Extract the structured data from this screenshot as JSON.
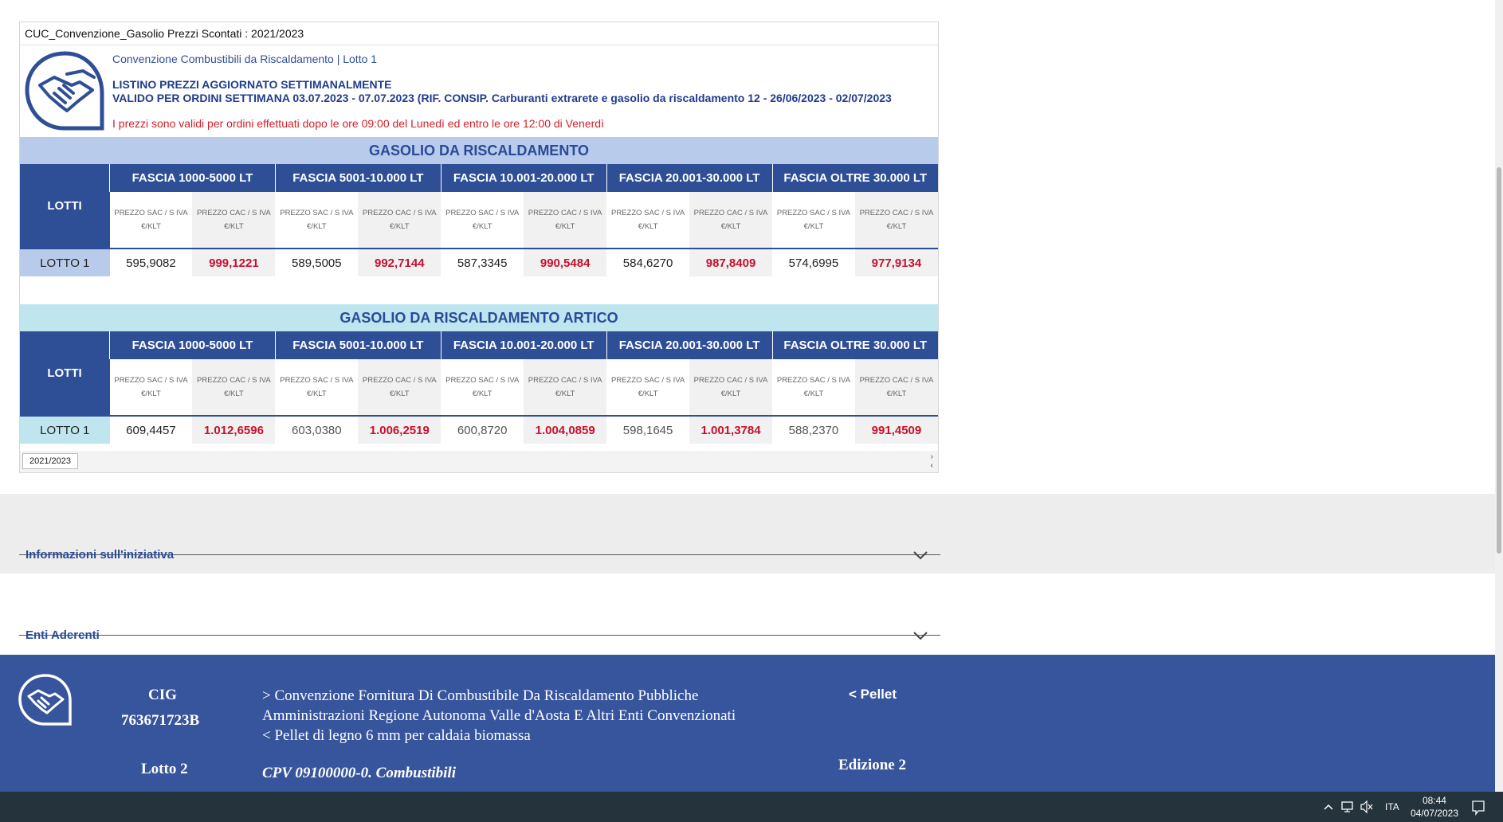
{
  "report": {
    "title": "CUC_Convenzione_Gasolio Prezzi Scontati : 2021/2023",
    "subtitle": "Convenzione Combustibili da Riscaldamento | Lotto 1",
    "headline_1": "LISTINO PREZZI AGGIORNATO SETTIMANALMENTE",
    "headline_2": "VALIDO PER ORDINI SETTIMANA 03.07.2023 - 07.07.2023 (RIF. CONSIP. Carburanti extrarete e gasolio da riscaldamento 12 - 26/06/2023 - 02/07/2023",
    "notice": "I prezzi sono validi per ordini effettuati dopo le ore 09:00 del Lunedì ed entro le ore 12:00 di Venerdì",
    "tab_label": "2021/2023",
    "scroll_right": "›",
    "scroll_left": "‹"
  },
  "tables": [
    {
      "title": "GASOLIO DA RISCALDAMENTO",
      "lotti_header": "LOTTI",
      "bands": [
        "FASCIA 1000-5000 LT",
        "FASCIA 5001-10.000 LT",
        "FASCIA 10.001-20.000 LT",
        "FASCIA 20.001-30.000 LT",
        "FASCIA OLTRE 30.000 LT"
      ],
      "sub_sac": "PREZZO SAC / S IVA",
      "sub_cac": "PREZZO CAC / S IVA",
      "unit": "€/KLT",
      "row": {
        "lot": "LOTTO 1",
        "values": [
          "595,9082",
          "999,1221",
          "589,5005",
          "992,7144",
          "587,3345",
          "990,5484",
          "584,6270",
          "987,8409",
          "574,6995",
          "977,9134"
        ]
      }
    },
    {
      "title": "GASOLIO DA RISCALDAMENTO ARTICO",
      "lotti_header": "LOTTI",
      "bands": [
        "FASCIA 1000-5000 LT",
        "FASCIA 5001-10.000 LT",
        "FASCIA 10.001-20.000 LT",
        "FASCIA 20.001-30.000 LT",
        "FASCIA OLTRE 30.000 LT"
      ],
      "sub_sac": "PREZZO SAC / S IVA",
      "sub_cac": "PREZZO CAC / S IVA",
      "unit": "€/KLT",
      "row": {
        "lot": "LOTTO 1",
        "values": [
          "609,4457",
          "1.012,6596",
          "603,0380",
          "1.006,2519",
          "600,8720",
          "1.004,0859",
          "598,1645",
          "1.001,3784",
          "588,2370",
          "991,4509"
        ]
      }
    }
  ],
  "accordions": [
    {
      "label": "Informazioni sull'iniziativa"
    },
    {
      "label": "Enti Aderenti"
    }
  ],
  "footer": {
    "cig_label": "CIG",
    "cig_value": "763671723B",
    "lotto": "Lotto 2",
    "desc_1": "> Convenzione Fornitura Di Combustibile Da Riscaldamento Pubbliche",
    "desc_2": "Amministrazioni Regione Autonoma Valle d'Aosta E Altri Enti Convenzionati",
    "desc_3": "< Pellet di legno 6 mm per caldaia biomassa",
    "cpv": "CPV  09100000-0. Combustibili",
    "pellet": "< Pellet",
    "edizione": "Edizione 2"
  },
  "taskbar": {
    "lang": "ITA",
    "time": "08:44",
    "date": "04/07/2023"
  },
  "colors": {
    "header_blue": "#2e4f96",
    "band_blue": "#b9cbea",
    "band_cyan": "#bfe5ee",
    "price_red": "#c8102e",
    "footer_blue": "#37559c"
  }
}
